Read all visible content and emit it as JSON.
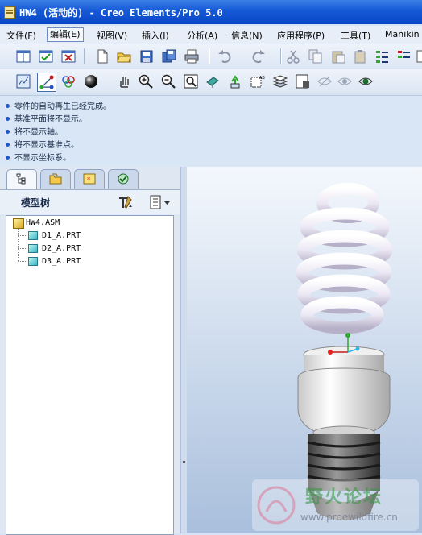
{
  "window": {
    "title": "HW4 (活动的) - Creo Elements/Pro 5.0"
  },
  "menu": [
    {
      "label": "文件(F)",
      "name": "menu-file"
    },
    {
      "label": "编辑(E)",
      "name": "menu-edit",
      "active": true
    },
    {
      "label": "视图(V)",
      "name": "menu-view"
    },
    {
      "label": "插入(I)",
      "name": "menu-insert"
    },
    {
      "label": "分析(A)",
      "name": "menu-analysis"
    },
    {
      "label": "信息(N)",
      "name": "menu-info"
    },
    {
      "label": "应用程序(P)",
      "name": "menu-applications"
    },
    {
      "label": "工具(T)",
      "name": "menu-tools"
    },
    {
      "label": "Manikin",
      "name": "menu-manikin"
    }
  ],
  "toolbar1": [
    "window-tile-icon",
    "window-activate-icon",
    "window-close-icon",
    "new-file-icon",
    "open-folder-icon",
    "save-icon",
    "save-copy-icon",
    "print-icon",
    "undo-icon",
    "redo-icon",
    "cut-icon",
    "copy-icon",
    "paste-icon",
    "paste-special-icon",
    "regenerate-icon",
    "regen-manager-icon",
    "find-icon"
  ],
  "toolbar2": [
    "sketch-icon",
    "datum-display-icon",
    "view-manager-icon",
    "appearance-sphere-icon",
    "pan-hand-icon",
    "zoom-in-icon",
    "zoom-out-icon",
    "refit-icon",
    "orient-icon",
    "spin-center-icon",
    "named-view-icon",
    "layers-icon",
    "model-tree-settings-icon",
    "hidden-line-icon",
    "no-hidden-icon",
    "shading-icon"
  ],
  "messages": [
    "零件的自动再生已经完成。",
    "基准平面将不显示。",
    "将不显示轴。",
    "将不显示基准点。",
    "不显示坐标系。"
  ],
  "navigator": {
    "tabs": [
      "tab-model-tree",
      "tab-folder-browser",
      "tab-favorites",
      "tab-connections"
    ],
    "title": "模型树"
  },
  "tree": {
    "root": "HW4.ASM",
    "parts": [
      "D1_A.PRT",
      "D2_A.PRT",
      "D3_A.PRT"
    ]
  },
  "watermark": {
    "title": "野火论坛",
    "url": "www.proewildfire.cn"
  },
  "colors": {
    "title_bar": "#1558d6",
    "bullet": "#2155c8",
    "accent_green": "#2fa82f"
  }
}
